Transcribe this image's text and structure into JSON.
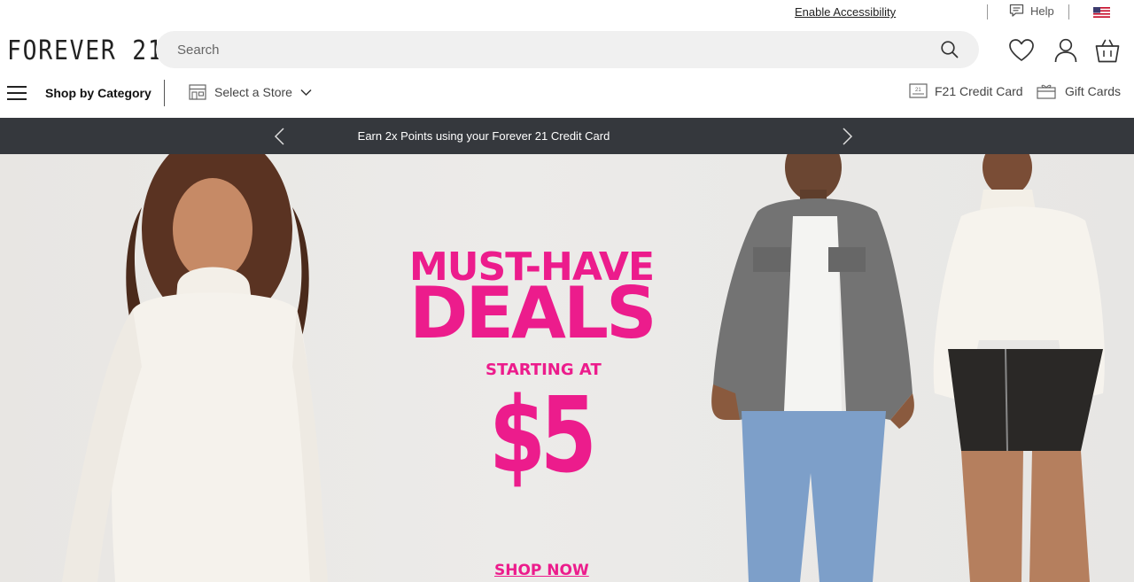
{
  "utility": {
    "accessibility_label": "Enable Accessibility",
    "help_label": "Help",
    "country_flag": "us-flag-icon"
  },
  "header": {
    "logo_text": "FOREVER 21",
    "search_placeholder": "Search",
    "search_value": "",
    "icons": [
      "heart-icon",
      "account-icon",
      "bag-icon"
    ]
  },
  "nav": {
    "shop_by_category": "Shop by Category",
    "select_store": "Select a Store",
    "credit_card": "F21 Credit Card",
    "gift_cards": "Gift Cards"
  },
  "promo": {
    "message": "Earn 2x Points using your Forever 21 Credit Card"
  },
  "hero": {
    "line1": "MUST-HAVE",
    "line2": "DEALS",
    "line3": "STARTING AT",
    "price": "$5",
    "cta": "SHOP NOW"
  },
  "colors": {
    "accent_pink": "#ec1c8c",
    "promo_bg": "#35383d",
    "search_bg": "#f0f0f0"
  }
}
